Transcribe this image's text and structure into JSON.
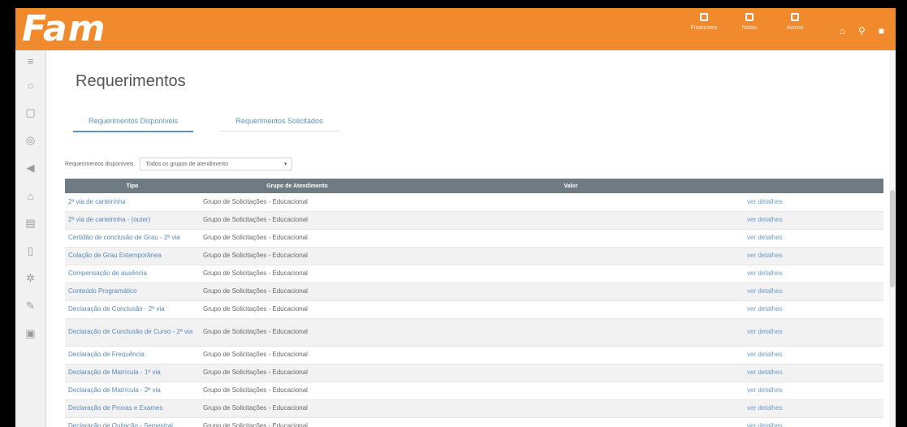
{
  "app": {
    "logo": "Fam"
  },
  "topbar": {
    "actions": [
      {
        "icon": "calendar-icon",
        "label": "Financeiro"
      },
      {
        "icon": "document-icon",
        "label": "Notas"
      },
      {
        "icon": "grid-icon",
        "label": "Avisos"
      }
    ],
    "icons": [
      "home-icon",
      "bell-icon",
      "user-icon"
    ]
  },
  "sidebar": {
    "items": [
      {
        "icon": "menu-icon",
        "glyph": "≡"
      },
      {
        "icon": "chat-icon",
        "glyph": "○"
      },
      {
        "icon": "calendar-icon",
        "glyph": "▢"
      },
      {
        "icon": "globe-icon",
        "glyph": "◎"
      },
      {
        "icon": "megaphone-icon",
        "glyph": "◀"
      },
      {
        "icon": "house-icon",
        "glyph": "⌂"
      },
      {
        "icon": "clipboard-icon",
        "glyph": "▤"
      },
      {
        "icon": "file-icon",
        "glyph": "▯"
      },
      {
        "icon": "settings-icon",
        "glyph": "✲"
      },
      {
        "icon": "pencil-icon",
        "glyph": "✎"
      },
      {
        "icon": "book-icon",
        "glyph": "▣"
      }
    ]
  },
  "page": {
    "title": "Requerimentos",
    "tabs": [
      {
        "label": "Requerimentos Disponíveis"
      },
      {
        "label": "Requerimentos Solicitados"
      }
    ],
    "filter": {
      "label": "Requerimentos disponíveis",
      "value": "Todos os grupos de atendimento",
      "arrow": "▾"
    }
  },
  "table": {
    "headers": [
      "Tipo",
      "Grupo de Atendimento",
      "Valor",
      ""
    ],
    "rows": [
      {
        "tipo": "2ª via de carteirinha",
        "grupo": "Grupo de Solicitações - Educacional",
        "valor": "",
        "acao": "ver detalhes"
      },
      {
        "tipo": "2ª via de carteirinha - (outer)",
        "grupo": "Grupo de Solicitações - Educacional",
        "valor": "",
        "acao": "ver detalhes"
      },
      {
        "tipo": "Certidão de conclusão de Grau - 2ª via",
        "grupo": "Grupo de Solicitações - Educacional",
        "valor": "",
        "acao": "ver detalhes"
      },
      {
        "tipo": "Colação de Grau Extemporânea",
        "grupo": "Grupo de Solicitações - Educacional",
        "valor": "",
        "acao": "ver detalhes"
      },
      {
        "tipo": "Compensação de ausência",
        "grupo": "Grupo de Solicitações - Educacional",
        "valor": "",
        "acao": "ver detalhes"
      },
      {
        "tipo": "Conteúdo Programático",
        "grupo": "Grupo de Solicitações - Educacional",
        "valor": "",
        "acao": "ver detalhes"
      },
      {
        "tipo": "Declaração de Conclusão - 2ª via",
        "grupo": "Grupo de Solicitações - Educacional",
        "valor": "",
        "acao": "ver detalhes"
      },
      {
        "tipo": "Declaração de Conclusão de Curso - 2ª via",
        "grupo": "Grupo de Solicitações - Educacional",
        "valor": "",
        "acao": "ver detalhes",
        "tall": true
      },
      {
        "tipo": "Declaração de Frequência",
        "grupo": "Grupo de Solicitações - Educacional",
        "valor": "",
        "acao": "ver detalhes"
      },
      {
        "tipo": "Declaração de Matrícula - 1ª via",
        "grupo": "Grupo de Solicitações - Educacional",
        "valor": "",
        "acao": "ver detalhes"
      },
      {
        "tipo": "Declaração de Matrícula - 2ª via",
        "grupo": "Grupo de Solicitações - Educacional",
        "valor": "",
        "acao": "ver detalhes"
      },
      {
        "tipo": "Declaração de Provas e Exames",
        "grupo": "Grupo de Solicitações - Educacional",
        "valor": "",
        "acao": "ver detalhes"
      },
      {
        "tipo": "Declaração de Quitação - Semestral",
        "grupo": "Grupo de Solicitações - Educacional",
        "valor": "",
        "acao": "ver detalhes"
      }
    ]
  }
}
